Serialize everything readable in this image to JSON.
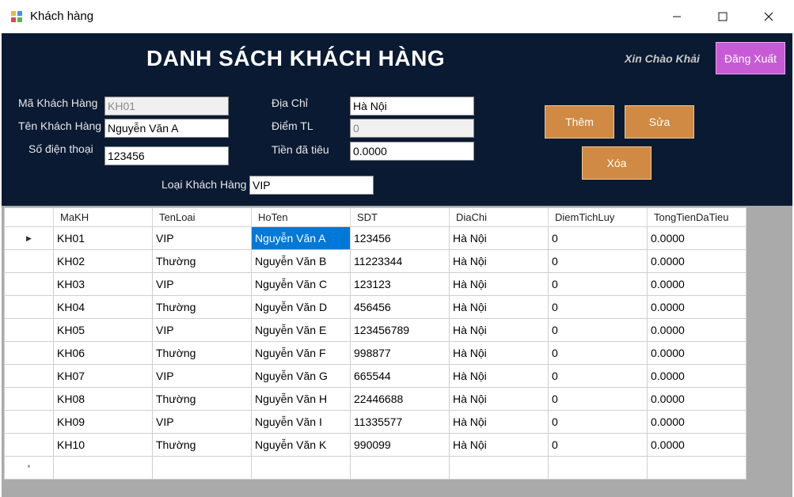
{
  "window": {
    "title": "Khách hàng",
    "minimize_icon": "minimize-icon",
    "maximize_icon": "maximize-icon",
    "close_icon": "close-icon"
  },
  "header": {
    "title": "DANH SÁCH KHÁCH HÀNG",
    "greeting": "Xin Chào Khải",
    "logout_label": "Đăng Xuất",
    "background_color": "#0a1a33"
  },
  "form": {
    "ma_kh_label": "Mã Khách Hàng",
    "ma_kh_value": "KH01",
    "ten_kh_label": "Tên Khách Hàng",
    "ten_kh_value": "Nguyễn Văn A",
    "sdt_label": "Số điện thoại",
    "sdt_value": "123456",
    "dia_chi_label": "Địa Chỉ",
    "dia_chi_value": "Hà Nội",
    "diem_tl_label": "Điểm TL",
    "diem_tl_value": "0",
    "tien_label": "Tiền đã tiêu",
    "tien_value": "0.0000",
    "loai_kh_label": "Loại Khách Hàng",
    "loai_kh_value": "VIP"
  },
  "actions": {
    "them": "Thêm",
    "sua": "Sửa",
    "xoa": "Xóa",
    "button_color": "#d08a43"
  },
  "grid": {
    "columns": [
      "MaKH",
      "TenLoai",
      "HoTen",
      "SDT",
      "DiaChi",
      "DiemTichLuy",
      "TongTienDaTieu"
    ],
    "current_row_indicator": "▶",
    "new_row_indicator": "*",
    "selected_color": "#0078d7",
    "rows": [
      [
        "KH01",
        "VIP",
        "Nguyễn Văn A",
        "123456",
        "Hà Nội",
        "0",
        "0.0000"
      ],
      [
        "KH02",
        "Thường",
        "Nguyễn Văn B",
        "11223344",
        "Hà Nội",
        "0",
        "0.0000"
      ],
      [
        "KH03",
        "VIP",
        "Nguyễn Văn C",
        "123123",
        "Hà Nội",
        "0",
        "0.0000"
      ],
      [
        "KH04",
        "Thường",
        "Nguyễn Văn D",
        "456456",
        "Hà Nội",
        "0",
        "0.0000"
      ],
      [
        "KH05",
        "VIP",
        "Nguyễn Văn E",
        "123456789",
        "Hà Nội",
        "0",
        "0.0000"
      ],
      [
        "KH06",
        "Thường",
        "Nguyễn Văn F",
        "998877",
        "Hà Nội",
        "0",
        "0.0000"
      ],
      [
        "KH07",
        "VIP",
        "Nguyễn Văn G",
        "665544",
        "Hà Nội",
        "0",
        "0.0000"
      ],
      [
        "KH08",
        "Thường",
        "Nguyễn Văn H",
        "22446688",
        "Hà Nội",
        "0",
        "0.0000"
      ],
      [
        "KH09",
        "VIP",
        "Nguyễn Văn I",
        "11335577",
        "Hà Nội",
        "0",
        "0.0000"
      ],
      [
        "KH10",
        "Thường",
        "Nguyễn Văn K",
        "990099",
        "Hà Nội",
        "0",
        "0.0000"
      ]
    ]
  }
}
